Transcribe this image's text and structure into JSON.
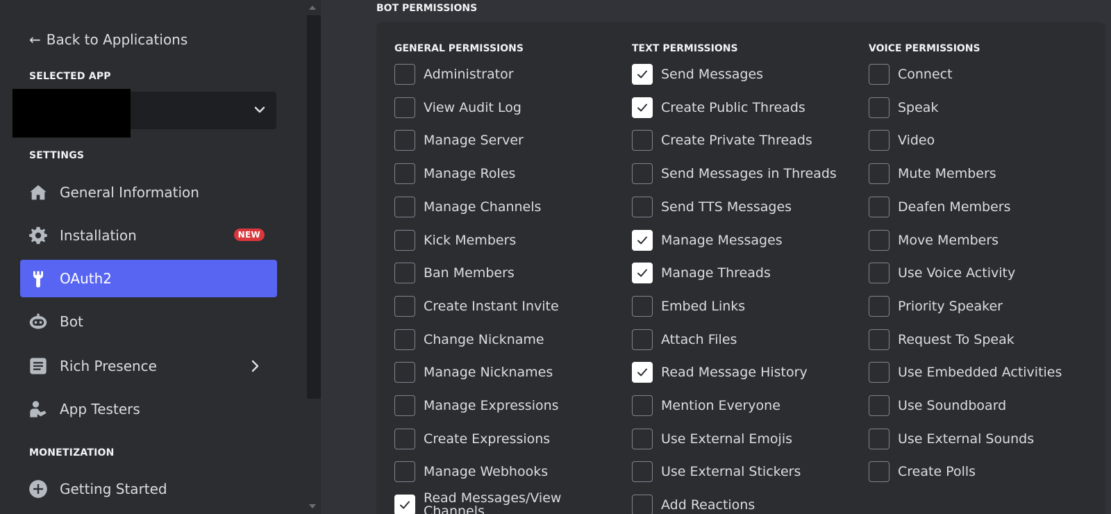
{
  "sidebar": {
    "back_label": "Back to Applications",
    "selected_app_label": "SELECTED APP",
    "settings_label": "SETTINGS",
    "monetization_label": "MONETIZATION",
    "nav": {
      "general": "General Information",
      "installation": "Installation",
      "installation_badge": "NEW",
      "oauth2": "OAuth2",
      "bot": "Bot",
      "rich_presence": "Rich Presence",
      "app_testers": "App Testers",
      "getting_started": "Getting Started"
    }
  },
  "main": {
    "section_title": "BOT PERMISSIONS",
    "columns": [
      {
        "header": "GENERAL PERMISSIONS",
        "items": [
          {
            "label": "Administrator",
            "checked": false
          },
          {
            "label": "View Audit Log",
            "checked": false
          },
          {
            "label": "Manage Server",
            "checked": false
          },
          {
            "label": "Manage Roles",
            "checked": false
          },
          {
            "label": "Manage Channels",
            "checked": false
          },
          {
            "label": "Kick Members",
            "checked": false
          },
          {
            "label": "Ban Members",
            "checked": false
          },
          {
            "label": "Create Instant Invite",
            "checked": false
          },
          {
            "label": "Change Nickname",
            "checked": false
          },
          {
            "label": "Manage Nicknames",
            "checked": false
          },
          {
            "label": "Manage Expressions",
            "checked": false
          },
          {
            "label": "Create Expressions",
            "checked": false
          },
          {
            "label": "Manage Webhooks",
            "checked": false
          },
          {
            "label": "Read Messages/View Channels",
            "checked": true
          }
        ]
      },
      {
        "header": "TEXT PERMISSIONS",
        "items": [
          {
            "label": "Send Messages",
            "checked": true
          },
          {
            "label": "Create Public Threads",
            "checked": true
          },
          {
            "label": "Create Private Threads",
            "checked": false
          },
          {
            "label": "Send Messages in Threads",
            "checked": false
          },
          {
            "label": "Send TTS Messages",
            "checked": false
          },
          {
            "label": "Manage Messages",
            "checked": true
          },
          {
            "label": "Manage Threads",
            "checked": true
          },
          {
            "label": "Embed Links",
            "checked": false
          },
          {
            "label": "Attach Files",
            "checked": false
          },
          {
            "label": "Read Message History",
            "checked": true
          },
          {
            "label": "Mention Everyone",
            "checked": false
          },
          {
            "label": "Use External Emojis",
            "checked": false
          },
          {
            "label": "Use External Stickers",
            "checked": false
          },
          {
            "label": "Add Reactions",
            "checked": false
          }
        ]
      },
      {
        "header": "VOICE PERMISSIONS",
        "items": [
          {
            "label": "Connect",
            "checked": false
          },
          {
            "label": "Speak",
            "checked": false
          },
          {
            "label": "Video",
            "checked": false
          },
          {
            "label": "Mute Members",
            "checked": false
          },
          {
            "label": "Deafen Members",
            "checked": false
          },
          {
            "label": "Move Members",
            "checked": false
          },
          {
            "label": "Use Voice Activity",
            "checked": false
          },
          {
            "label": "Priority Speaker",
            "checked": false
          },
          {
            "label": "Request To Speak",
            "checked": false
          },
          {
            "label": "Use Embedded Activities",
            "checked": false
          },
          {
            "label": "Use Soundboard",
            "checked": false
          },
          {
            "label": "Use External Sounds",
            "checked": false
          },
          {
            "label": "Create Polls",
            "checked": false
          }
        ]
      }
    ]
  },
  "colors": {
    "accent": "#5865f2",
    "badge": "#da373c",
    "sidebar_bg": "#2b2d31",
    "main_bg": "#313338"
  }
}
